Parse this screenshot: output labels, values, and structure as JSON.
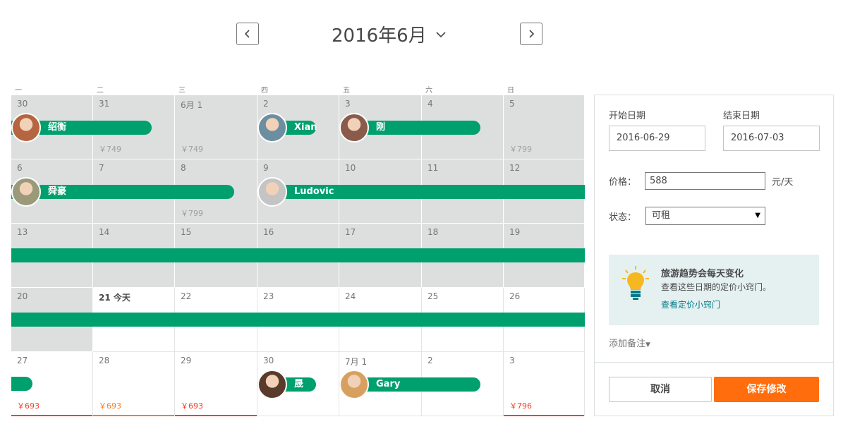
{
  "header": {
    "month_title": "2016年6月",
    "prev_icon": "chevron-left-icon",
    "next_icon": "chevron-right-icon",
    "dropdown_icon": "chevron-down-icon"
  },
  "weekdays": [
    "一",
    "二",
    "三",
    "四",
    "五",
    "六",
    "日"
  ],
  "weeks": [
    {
      "days": [
        {
          "label": "30",
          "past": true
        },
        {
          "label": "31",
          "past": true,
          "price": "￥749"
        },
        {
          "label": "6月 1",
          "past": true,
          "price": "￥749"
        },
        {
          "label": "2",
          "past": true
        },
        {
          "label": "3",
          "past": true
        },
        {
          "label": "4",
          "past": true
        },
        {
          "label": "5",
          "past": true,
          "price": "￥799"
        }
      ]
    },
    {
      "days": [
        {
          "label": "6",
          "past": true
        },
        {
          "label": "7",
          "past": true
        },
        {
          "label": "8",
          "past": true,
          "price": "￥799"
        },
        {
          "label": "9",
          "past": true
        },
        {
          "label": "10",
          "past": true
        },
        {
          "label": "11",
          "past": true
        },
        {
          "label": "12",
          "past": true
        }
      ]
    },
    {
      "days": [
        {
          "label": "13",
          "past": true
        },
        {
          "label": "14",
          "past": true
        },
        {
          "label": "15",
          "past": true
        },
        {
          "label": "16",
          "past": true
        },
        {
          "label": "17",
          "past": true
        },
        {
          "label": "18",
          "past": true
        },
        {
          "label": "19",
          "past": true
        }
      ]
    },
    {
      "days": [
        {
          "label": "20",
          "past": true
        },
        {
          "label": "21 今天",
          "today": true
        },
        {
          "label": "22"
        },
        {
          "label": "23"
        },
        {
          "label": "24"
        },
        {
          "label": "25"
        },
        {
          "label": "26"
        }
      ]
    },
    {
      "days": [
        {
          "label": "27",
          "price": "￥693",
          "price_color": "red"
        },
        {
          "label": "28",
          "price": "￥693",
          "price_color": "orange"
        },
        {
          "label": "29",
          "price": "￥693",
          "price_color": "red"
        },
        {
          "label": "30"
        },
        {
          "label": "7月 1"
        },
        {
          "label": "2"
        },
        {
          "label": "3",
          "price": "￥796",
          "price_color": "red"
        }
      ]
    }
  ],
  "bookings": [
    {
      "name": "绍衡",
      "week": 0,
      "start": 0,
      "end": 1,
      "avatar_color": "#b5653f",
      "cut_left": true
    },
    {
      "name": "Xian",
      "week": 0,
      "start": 3,
      "end": 3,
      "avatar_color": "#6b8fa0"
    },
    {
      "name": "刚",
      "week": 0,
      "start": 4,
      "end": 5,
      "avatar_color": "#8a5a4a"
    },
    {
      "name": "舜豪",
      "week": 1,
      "start": 0,
      "end": 2,
      "avatar_color": "#9a9a7a",
      "cut_left": true
    },
    {
      "name": "Ludovic",
      "week": 1,
      "start": 3,
      "end": 6,
      "avatar_color": "#c4c4c4",
      "cut_right": true
    },
    {
      "name": "",
      "week": 2,
      "start": 0,
      "end": 6,
      "cut_left": true,
      "cut_right": true
    },
    {
      "name": "",
      "week": 3,
      "start": 0,
      "end": 6,
      "cut_left": true,
      "cut_right": true
    },
    {
      "name": "",
      "week": 4,
      "start": 0,
      "end": 0,
      "cut_left": true,
      "short": true
    },
    {
      "name": "晟",
      "week": 4,
      "start": 3,
      "end": 3,
      "avatar_color": "#5a3a2a"
    },
    {
      "name": "Gary",
      "week": 4,
      "start": 4,
      "end": 5,
      "avatar_color": "#d8a060"
    }
  ],
  "panel": {
    "start_label": "开始日期",
    "end_label": "结束日期",
    "start_value": "2016-06-29",
    "end_value": "2016-07-03",
    "price_label": "价格：",
    "price_value": "588",
    "price_unit": "元/天",
    "status_label": "状态：",
    "status_value": "可租",
    "tip_title": "旅游趋势会每天变化",
    "tip_text": "查看这些日期的定价小窍门。",
    "tip_link": "查看定价小窍门",
    "add_note": "添加备注",
    "cancel": "取消",
    "save": "保存修改",
    "colors": {
      "accent_green": "#00a06e",
      "save_orange": "#ff6d0c",
      "link_teal": "#007a87"
    }
  }
}
